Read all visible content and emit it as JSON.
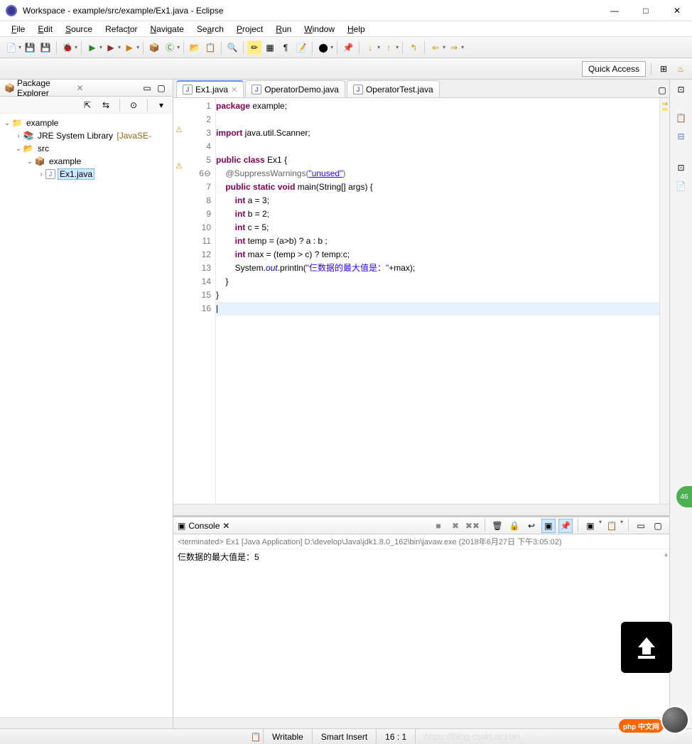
{
  "window": {
    "title": "Workspace - example/src/example/Ex1.java - Eclipse",
    "minimize": "—",
    "maximize": "□",
    "close": "✕"
  },
  "menu": [
    "File",
    "Edit",
    "Source",
    "Refactor",
    "Navigate",
    "Search",
    "Project",
    "Run",
    "Window",
    "Help"
  ],
  "quick_access": "Quick Access",
  "package_explorer": {
    "title": "Package Explorer",
    "tree": {
      "project": "example",
      "jre": "JRE System Library",
      "jre_suffix": "[JavaSE-",
      "src": "src",
      "pkg": "example",
      "file": "Ex1.java"
    }
  },
  "editor": {
    "tabs": [
      {
        "label": "Ex1.java",
        "active": true
      },
      {
        "label": "OperatorDemo.java",
        "active": false
      },
      {
        "label": "OperatorTest.java",
        "active": false
      }
    ],
    "lines": [
      "1",
      "2",
      "3",
      "4",
      "5",
      "6",
      "7",
      "8",
      "9",
      "10",
      "11",
      "12",
      "13",
      "14",
      "15",
      "16"
    ],
    "code": {
      "l1_kw": "package",
      "l1_rest": " example;",
      "l3_kw": "import",
      "l3_rest": " java.util.Scanner;",
      "l5_kw1": "public",
      "l5_kw2": "class",
      "l5_rest": " Ex1 {",
      "l6_ann": "    @SuppressWarnings(",
      "l6_str": "\"unused\"",
      "l6_end": ")",
      "l7_pre": "    ",
      "l7_kw1": "public",
      "l7_kw2": "static",
      "l7_kw3": "void",
      "l7_rest": " main(String[] args) {",
      "l8_pre": "        ",
      "l8_kw": "int",
      "l8_rest": " a = 3;",
      "l9_pre": "        ",
      "l9_kw": "int",
      "l9_rest": " b = 2;",
      "l10_pre": "        ",
      "l10_kw": "int",
      "l10_rest": " c = 5;",
      "l11_pre": "        ",
      "l11_kw": "int",
      "l11_rest": " temp = (a>b) ? a : b ;",
      "l12_pre": "        ",
      "l12_kw": "int",
      "l12_rest": " max = (temp > c) ? temp:c;",
      "l13_pre": "        System.",
      "l13_out": "out",
      "l13_mid": ".println(",
      "l13_str": "\"仨数据的最大值是：\"",
      "l13_end": "+max);",
      "l14": "    }",
      "l15": "}",
      "l16": ""
    }
  },
  "console": {
    "title": "Console",
    "sub": "<terminated> Ex1 [Java Application] D:\\develop\\Java\\jdk1.8.0_162\\bin\\javaw.exe (2018年6月27日 下午3:05:02)",
    "output": "仨数据的最大值是：5"
  },
  "status": {
    "writable": "Writable",
    "insert": "Smart Insert",
    "pos": "16 : 1",
    "watermark": "https://blog.csdn.net/an"
  },
  "badges": {
    "green": "46",
    "php": "php 中文网"
  }
}
